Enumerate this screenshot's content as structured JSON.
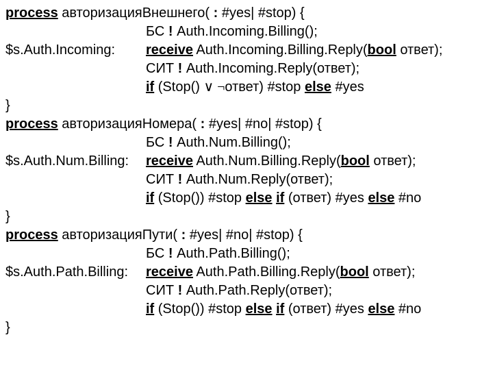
{
  "p1": {
    "header": {
      "kw": "process",
      "name": "авторизацияВнешнего( ",
      "colon": ":",
      "sig": " #yes| #stop) {"
    },
    "l1": {
      "pre": "БС ",
      "bang": "!",
      "post": " Auth.Incoming.Billing();"
    },
    "l2": {
      "label": "  $s.Auth.Incoming:",
      "kw": "receive",
      "mid": " Auth.Incoming.Billing.Reply(",
      "type": "bool",
      "post": " ответ);"
    },
    "l3": {
      "pre": "СИТ ",
      "bang": "!",
      "post": " Auth.Incoming.Reply(ответ);"
    },
    "l4": {
      "kw1": "if",
      "a": " (Stop() ",
      "op": "∨ ¬",
      "b": "ответ)  #stop ",
      "kw2": "else",
      "c": " #yes"
    },
    "close": "}"
  },
  "p2": {
    "header": {
      "kw": "process",
      "name": "авторизацияНомера( ",
      "colon": ":",
      "sig": " #yes| #no| #stop) {"
    },
    "l1": {
      "pre": "БС ",
      "bang": "!",
      "post": " Auth.Num.Billing();"
    },
    "l2": {
      "label": "$s.Auth.Num.Billing:",
      "kw": "receive",
      "mid": "  Auth.Num.Billing.Reply(",
      "type": "bool",
      "post": " ответ);"
    },
    "l3": {
      "pre": "СИТ ",
      "bang": "!",
      "post": " Auth.Num.Reply(ответ);"
    },
    "l4": {
      "kw1": "if",
      "a": " (Stop()) #stop ",
      "kw2": "else",
      "b": " ",
      "kw3": "if",
      "c": " (ответ) #yes ",
      "kw4": "else",
      "d": " #no"
    },
    "close": "}"
  },
  "p3": {
    "header": {
      "kw": "process",
      "name": "авторизацияПути( ",
      "colon": ":",
      "sig": " #yes| #no| #stop) {"
    },
    "l1": {
      "pre": "БС ",
      "bang": "!",
      "post": " Auth.Path.Billing();"
    },
    "l2": {
      "label": "$s.Auth.Path.Billing:",
      "kw": "receive",
      "mid": "  Auth.Path.Billing.Reply(",
      "type": "bool",
      "post": " ответ);"
    },
    "l3": {
      "pre": "СИТ ",
      "bang": "!",
      "post": " Auth.Path.Reply(ответ);"
    },
    "l4": {
      "kw1": "if",
      "a": " (Stop()) #stop ",
      "kw2": "else",
      "b": " ",
      "kw3": "if",
      "c": " (ответ) #yes ",
      "kw4": "else",
      "d": " #no"
    },
    "close": "}"
  }
}
